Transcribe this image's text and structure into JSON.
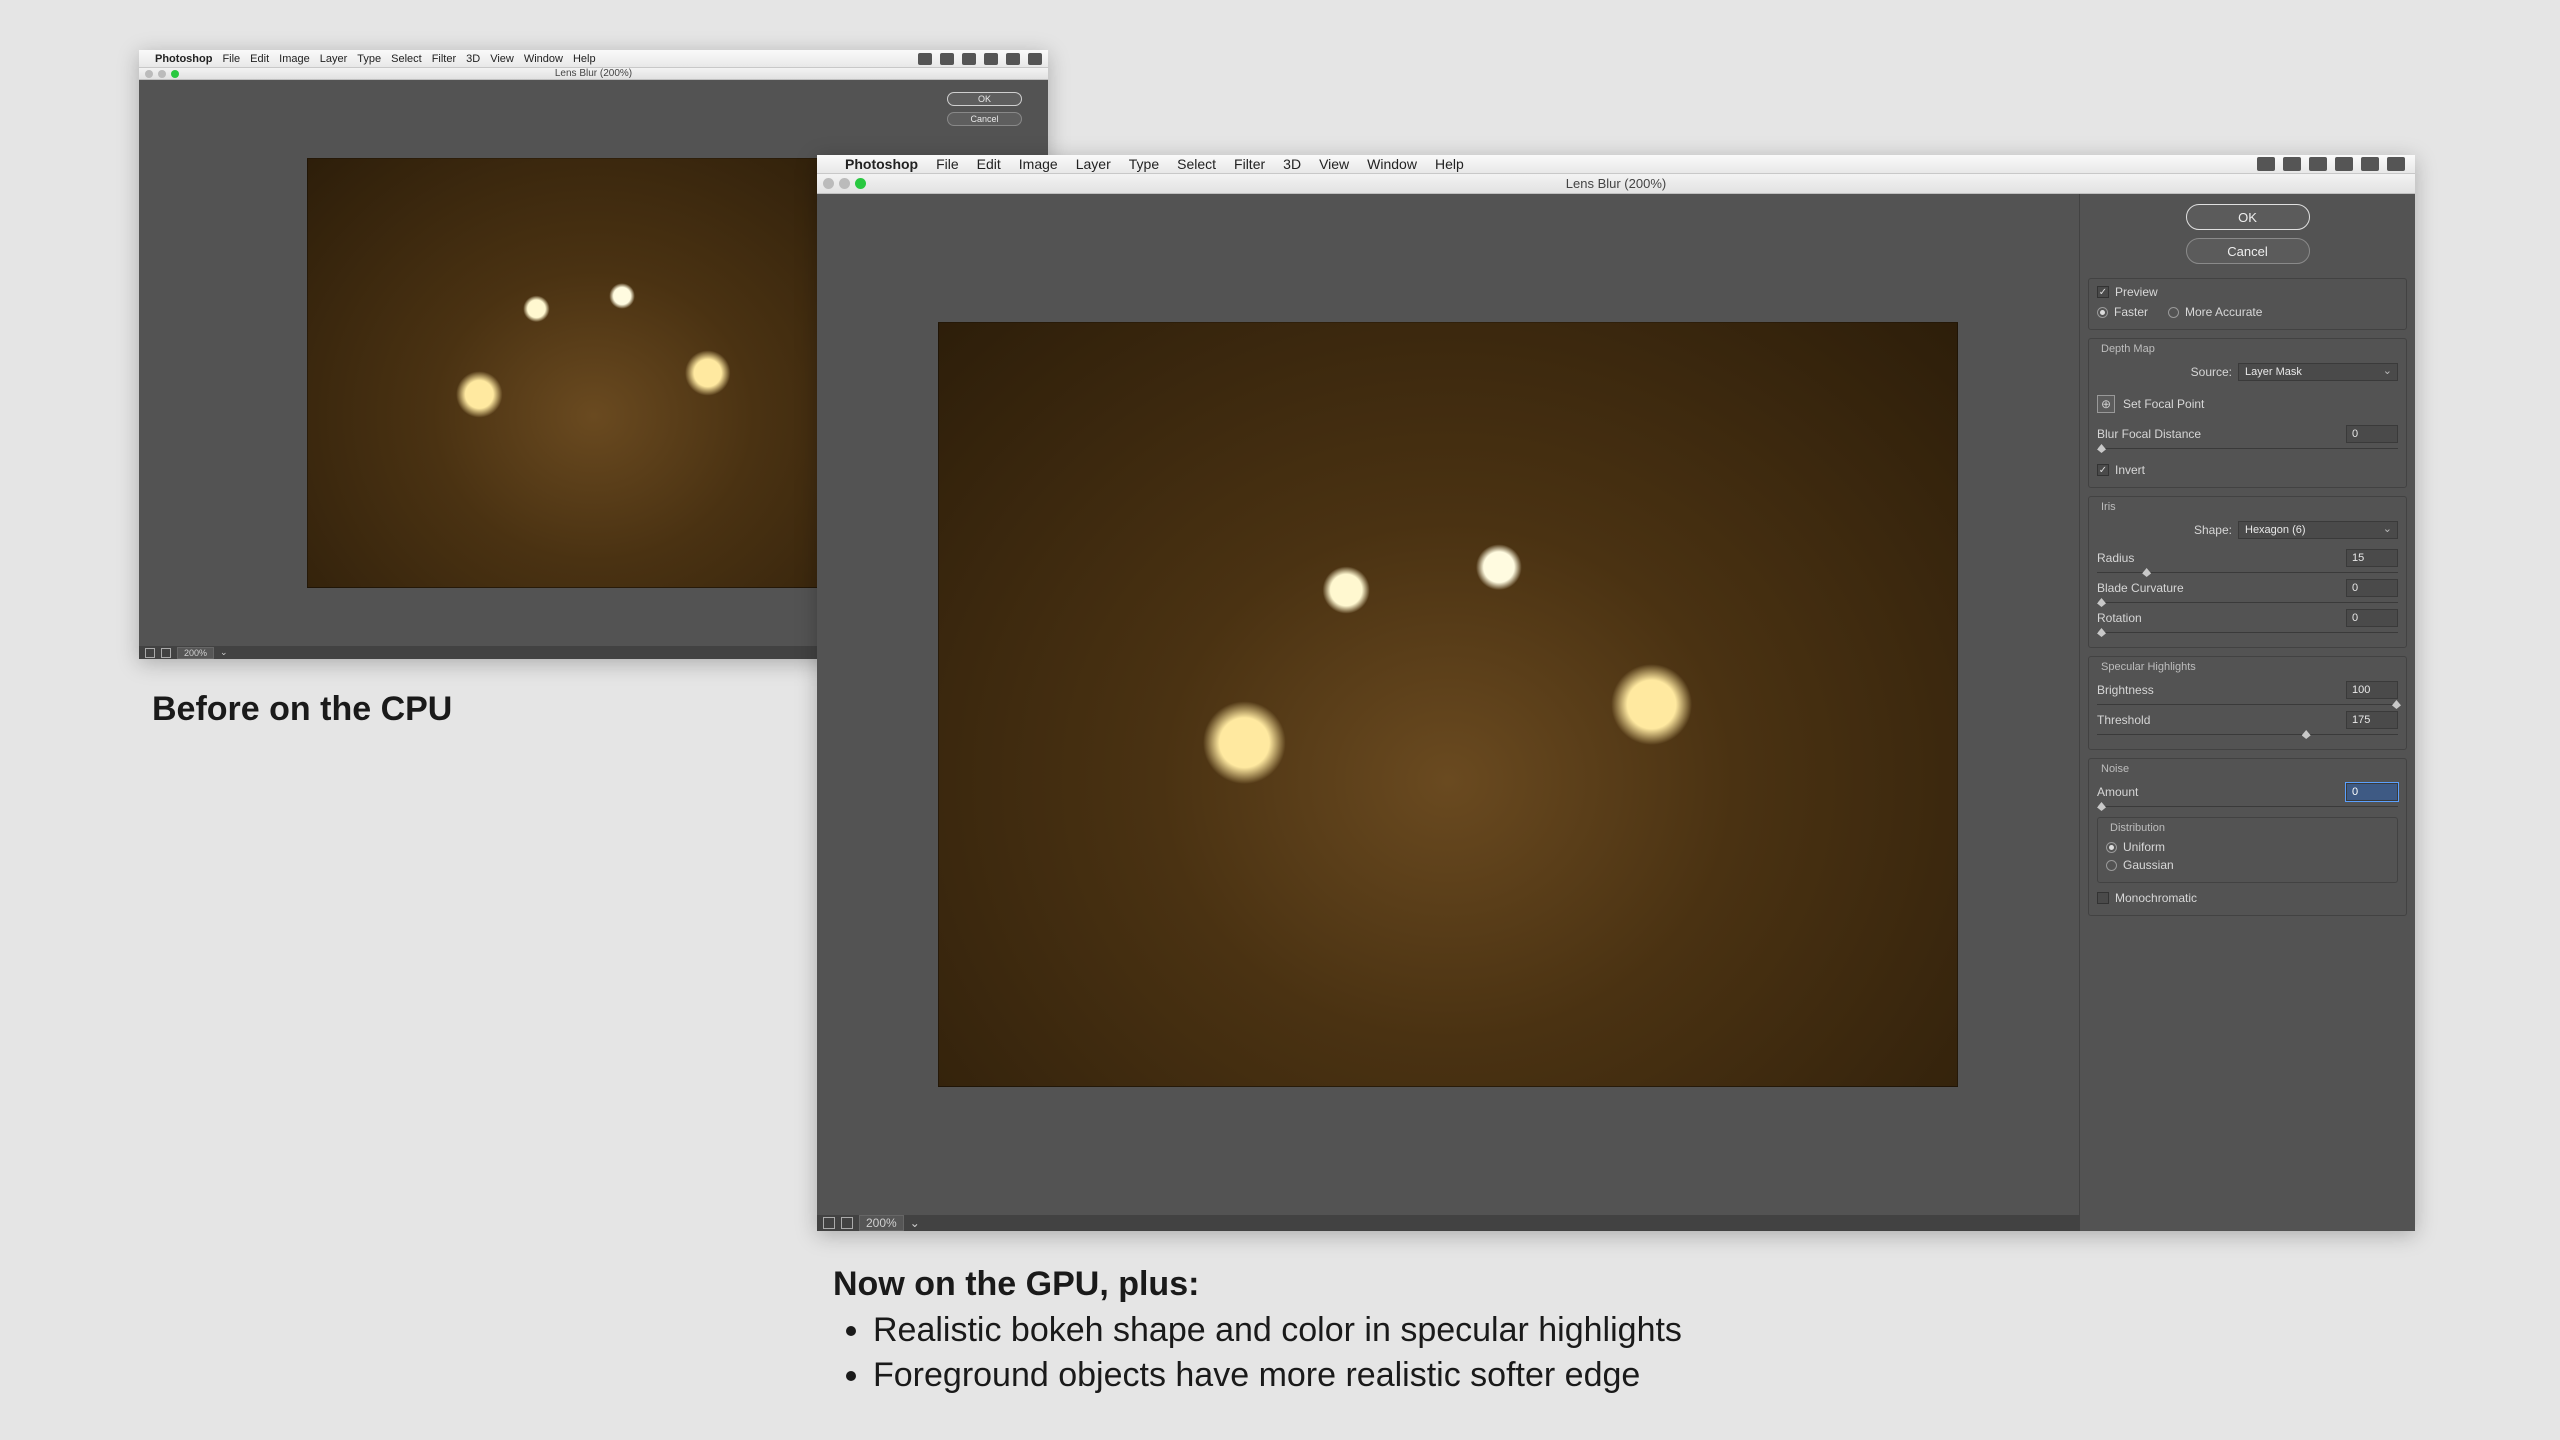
{
  "menus": {
    "apple": "",
    "appname": "Photoshop",
    "items": [
      "File",
      "Edit",
      "Image",
      "Layer",
      "Type",
      "Select",
      "Filter",
      "3D",
      "View",
      "Window",
      "Help"
    ]
  },
  "window_title": "Lens Blur (200%)",
  "buttons": {
    "ok": "OK",
    "cancel": "Cancel"
  },
  "preview": {
    "label": "Preview",
    "checked": true,
    "faster": "Faster",
    "accurate": "More Accurate",
    "mode": "faster"
  },
  "depthmap": {
    "title": "Depth Map",
    "source_label": "Source:",
    "source_value": "Layer Mask",
    "focal_point": "Set Focal Point",
    "blur_focal_distance_label": "Blur Focal Distance",
    "blur_focal_distance_value": "0",
    "invert_label": "Invert",
    "invert_checked": true
  },
  "iris": {
    "title": "Iris",
    "shape_label": "Shape:",
    "shape_value": "Hexagon (6)",
    "radius_label": "Radius",
    "radius_value": "15",
    "blade_label": "Blade Curvature",
    "blade_value": "0",
    "rotation_label": "Rotation",
    "rotation_value": "0"
  },
  "specular": {
    "title": "Specular Highlights",
    "brightness_label": "Brightness",
    "brightness_value": "100",
    "threshold_label": "Threshold",
    "threshold_value": "175"
  },
  "noise": {
    "title": "Noise",
    "amount_label": "Amount",
    "amount_value": "0",
    "distribution_label": "Distribution",
    "uniform": "Uniform",
    "gaussian": "Gaussian",
    "selected": "uniform",
    "mono_label": "Monochromatic",
    "mono_checked": false
  },
  "footer": {
    "zoom": "200%"
  },
  "captions": {
    "before": "Before on the CPU",
    "after_heading": "Now on the GPU, plus:",
    "after_b1": "Realistic bokeh shape and color in specular highlights",
    "after_b2": "Foreground objects have more realistic softer edge"
  }
}
